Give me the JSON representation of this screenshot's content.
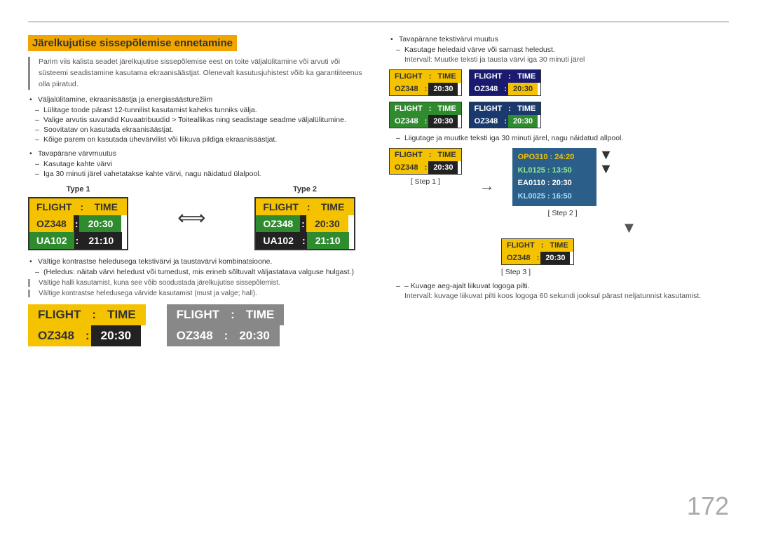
{
  "page": {
    "number": "172",
    "topline": true
  },
  "section": {
    "title": "Järelkujutise sissepõlemise ennetamine",
    "intro": "Parim viis kalista seadet järelkujutise sissepõlemise eest on toite väljalülitamine või arvuti või süsteemi seadistamine kasutama ekraanisäästjat. Olenevalt kasutusjuhistest võib ka garantiiteenus olla piiratud.",
    "bullets": [
      {
        "text": "Väljalülitamine, ekraanisäästja ja energiasäästurežiim",
        "dashes": [
          "Lülitage toode pärast 12-tunnilist kasutamist kaheks tunniks välja.",
          "Valige arvutis suvandid Kuvaatribuudid > Toiteallikas ning seadistage seadme väljalülitumine.",
          "Soovitatav on kasutada ekraanisäästjat.",
          "Kõige parem on kasutada ühevärvilist või liikuva pildiga ekraanisäästjat."
        ]
      },
      {
        "text": "Tavapärane värvmuutus",
        "dashes": [
          "Kasutage kahte värvi",
          "Iga 30 minuti järel vahetatakse kahte värvi, nagu näidatud ülalpool."
        ]
      }
    ],
    "type1_label": "Type 1",
    "type2_label": "Type 2",
    "warnings": [
      "Vältige kontrastse heledusega tekstivärvi ja taustavärvi kombinatsioone.",
      "(Heledus: näitab värvi heledust või tumedust, mis erineb sõltuvalt väljastatava valguse hulgast.)",
      "Vältige halli kasutamist, kuna see võib soodustada järelkujutise sissepõlemist.",
      "Vältige kontrastse heledusega värvide kasutamist (must ja valge; hall)."
    ]
  },
  "right": {
    "bullet1": "Tavapärane tekstivärvi muutus",
    "dash1": "Kasutage heledaid värve või sarnast heledust.",
    "interval1": "Intervall: Muutke teksti ja tausta värvi iga 30 minuti järel",
    "dash2": "Liigutage ja muutke teksti iga 30 minuti järel, nagu näidatud allpool.",
    "interval2": "Intervall: kuvage liikuvat pilti koos logoga 60 sekundi jooksul pärast neljatunnist kasutamist.",
    "step1_label": "[ Step 1 ]",
    "step2_label": "[ Step 2 ]",
    "step3_label": "[ Step 3 ]",
    "kuvage_text": "– Kuvage aeg-ajalt liikuvat logoga pilti.",
    "kuvage_interval": "Intervall: kuvage liikuvat pilti koos logoga 60 sekundi jooksul pärast neljatunnist kasutamist."
  },
  "flight_boards": {
    "type1_rows": [
      {
        "label1": "FLIGHT",
        "label2": "TIME",
        "style": "header"
      },
      {
        "label1": "OZ348",
        "label2": "20:30",
        "style": "yellow-green"
      },
      {
        "label1": "UA102",
        "label2": "21:10",
        "style": "green-dark"
      }
    ],
    "type2_rows": [
      {
        "label1": "FLIGHT",
        "label2": "TIME",
        "style": "header"
      },
      {
        "label1": "OZ348",
        "label2": "20:30",
        "style": "yellow-green"
      },
      {
        "label1": "UA102",
        "label2": "21:10",
        "style": "green-dark"
      }
    ],
    "color_variants": [
      {
        "header1": "FLIGHT",
        "sep": ":",
        "header2": "TIME",
        "val1": "OZ348",
        "vsep": ":",
        "val2": "20:30",
        "hstyle": "yb",
        "vstyle": "yd"
      },
      {
        "header1": "FLIGHT",
        "sep": ":",
        "header2": "TIME",
        "val1": "OZ348",
        "vsep": ":",
        "val2": "20:30",
        "hstyle": "gb",
        "vstyle": "gd"
      },
      {
        "header1": "FLIGHT",
        "sep": ":",
        "header2": "TIME",
        "val1": "OZ348",
        "vsep": ":",
        "val2": "20:30",
        "hstyle": "ob",
        "vstyle": "od"
      },
      {
        "header1": "FLIGHT",
        "sep": ":",
        "header2": "TIME",
        "val1": "OZ348",
        "vsep": ":",
        "val2": "20:30",
        "hstyle": "pb",
        "vstyle": "pd"
      }
    ],
    "bottom_black": {
      "header1": "FLIGHT",
      "sep": ":",
      "header2": "TIME",
      "val1": "OZ348",
      "vsep": ":",
      "val2": "20:30"
    },
    "bottom_gray": {
      "header1": "FLIGHT",
      "sep": ":",
      "header2": "TIME",
      "val1": "OZ348",
      "vsep": ":",
      "val2": "20:30"
    },
    "step1": {
      "header1": "FLIGHT",
      "sep": ":",
      "header2": "TIME",
      "val1": "OZ348",
      "vsep": ":",
      "val2": "20:30"
    },
    "step3": {
      "header1": "FLIGHT",
      "sep": ":",
      "header2": "TIME",
      "val1": "OZ348",
      "vsep": ":",
      "val2": "20:30"
    }
  }
}
